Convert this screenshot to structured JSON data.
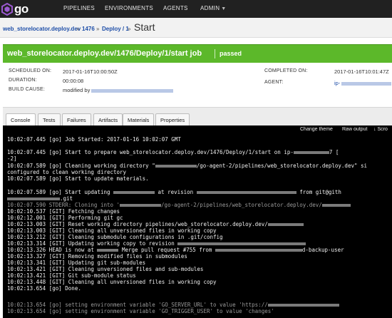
{
  "nav": {
    "logo_text": "go",
    "items": [
      "PIPELINES",
      "ENVIRONMENTS",
      "AGENTS",
      "ADMIN"
    ]
  },
  "breadcrumb": {
    "pipeline": "web_storelocator.deploy.dev",
    "counter": "1476",
    "stage": "Deploy / 1",
    "current": "Start"
  },
  "job": {
    "title": "web_storelocator.deploy.dev/1476/Deploy/1/start job",
    "status": "passed"
  },
  "info": {
    "scheduled_label": "SCHEDULED ON:",
    "scheduled_value": "2017-01-16T10:00:50Z",
    "duration_label": "DURATION:",
    "duration_value": "00:00:08",
    "cause_label": "BUILD CAUSE:",
    "cause_value": "modified by",
    "completed_label": "COMPLETED ON:",
    "completed_value": "2017-01-16T10:01:47Z",
    "agent_label": "AGENT:",
    "agent_value": "ip-"
  },
  "tabs": [
    "Console",
    "Tests",
    "Failures",
    "Artifacts",
    "Materials",
    "Properties"
  ],
  "console_tools": [
    "Change theme",
    "Raw output",
    "↓ Scro"
  ],
  "console": [
    {
      "a": "10:02:07.445 [go] Job Started: 2017-01-16 10:02:07 GMT",
      "r": 0,
      "b": ""
    },
    {
      "a": "10:02:07.445 [go] Start to prepare web_storelocator.deploy.dev/1476/Deploy/1/start on ip-",
      "r": 50,
      "b": "7 ["
    },
    {
      "a": "-2]",
      "r": 0,
      "b": ""
    },
    {
      "a": "10:02:07.589 [go] Cleaning working directory \"",
      "r": 58,
      "b": "/go-agent-2/pipelines/web_storelocator.deploy.dev\" si"
    },
    {
      "a": "configured to clean working directory",
      "r": 0,
      "b": ""
    },
    {
      "a": "10:02:07.589 [go] Start to update materials.",
      "r": 0,
      "b": ""
    },
    {
      "a": "10:02:07.589 [go] Start updating ",
      "r": 58,
      "b": " at revision "
    },
    {
      "a": "10:02:07.590 STDERR: Cloning into '",
      "r": 58,
      "b": "/go-agent-2/pipelines/web_storelocator.deploy.dev/"
    },
    {
      "a": "10:02:10.537 [GIT] Fetching changes",
      "r": 0,
      "b": ""
    },
    {
      "a": "10:02:12.001 [GIT] Performing git gc",
      "r": 0,
      "b": ""
    },
    {
      "a": "10:02:13.003 [GIT] Reset working directory pipelines/web_storelocator.deploy.dev/",
      "r": 0,
      "b": ""
    },
    {
      "a": "10:02:13.003 [GIT] Cleaning all unversioned files in working copy",
      "r": 0,
      "b": ""
    },
    {
      "a": "10:02:13.212 [GIT] Cleaning submodule configurations in .git/config",
      "r": 0,
      "b": ""
    },
    {
      "a": "10:02:13.314 [GIT] Updating working copy to revision ",
      "r": 0,
      "b": ""
    },
    {
      "a": "10:02:13.326 HEAD is now at ",
      "r": 30,
      "b": " Merge pull request #755 from "
    },
    {
      "a": "10:02:13.327 [GIT] Removing modified files in submodules",
      "r": 0,
      "b": ""
    },
    {
      "a": "10:02:13.341 [GIT] Updating git sub-modules",
      "r": 0,
      "b": ""
    },
    {
      "a": "10:02:13.421 [GIT] Cleaning unversioned files and sub-modules",
      "r": 0,
      "b": ""
    },
    {
      "a": "10:02:13.421 [GIT] Git sub-module status",
      "r": 0,
      "b": ""
    },
    {
      "a": "10:02:13.448 [GIT] Cleaning all unversioned files in working copy",
      "r": 0,
      "b": ""
    },
    {
      "a": "10:02:13.654 [go] Done.",
      "r": 0,
      "b": ""
    },
    {
      "a": "10:02:13.654 [go] setting environment variable 'GO_SERVER_URL' to value 'https://",
      "r": 0,
      "b": ""
    },
    {
      "a": "10:02:13.654 [go] setting environment variable 'GO_TRIGGER_USER' to value 'changes'",
      "r": 0,
      "b": ""
    }
  ],
  "console_extra": {
    "from_git": "from git@gith",
    "git_suffix": ".git",
    "backup_user": "d-backup-user"
  },
  "colors": {
    "nav_bg": "#212121",
    "passed_green": "#5cb82a",
    "link_blue": "#1e4ea8",
    "console_bg": "#000000"
  }
}
